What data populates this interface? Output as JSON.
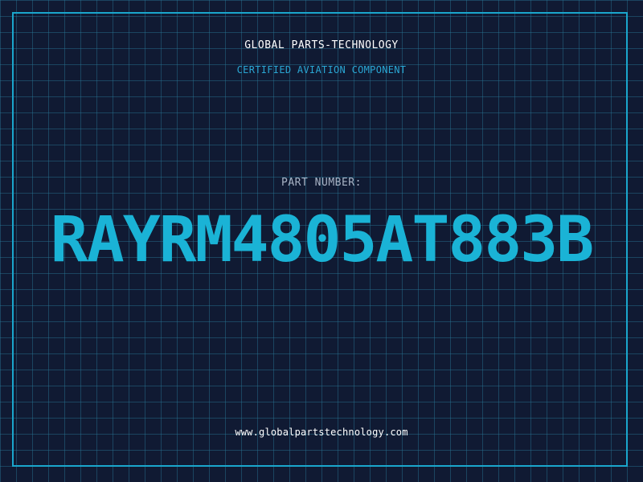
{
  "header": {
    "brand": "GLOBAL PARTS-TECHNOLOGY",
    "tagline": "CERTIFIED AVIATION COMPONENT"
  },
  "part": {
    "label": "PART NUMBER:",
    "number": "RAYRM4805AT883B"
  },
  "footer": {
    "website": "www.globalpartstechnology.com"
  },
  "colors": {
    "background": "#101a33",
    "grid": "#287896",
    "accent": "#1ab3d6",
    "frame": "#1aa6cc"
  }
}
